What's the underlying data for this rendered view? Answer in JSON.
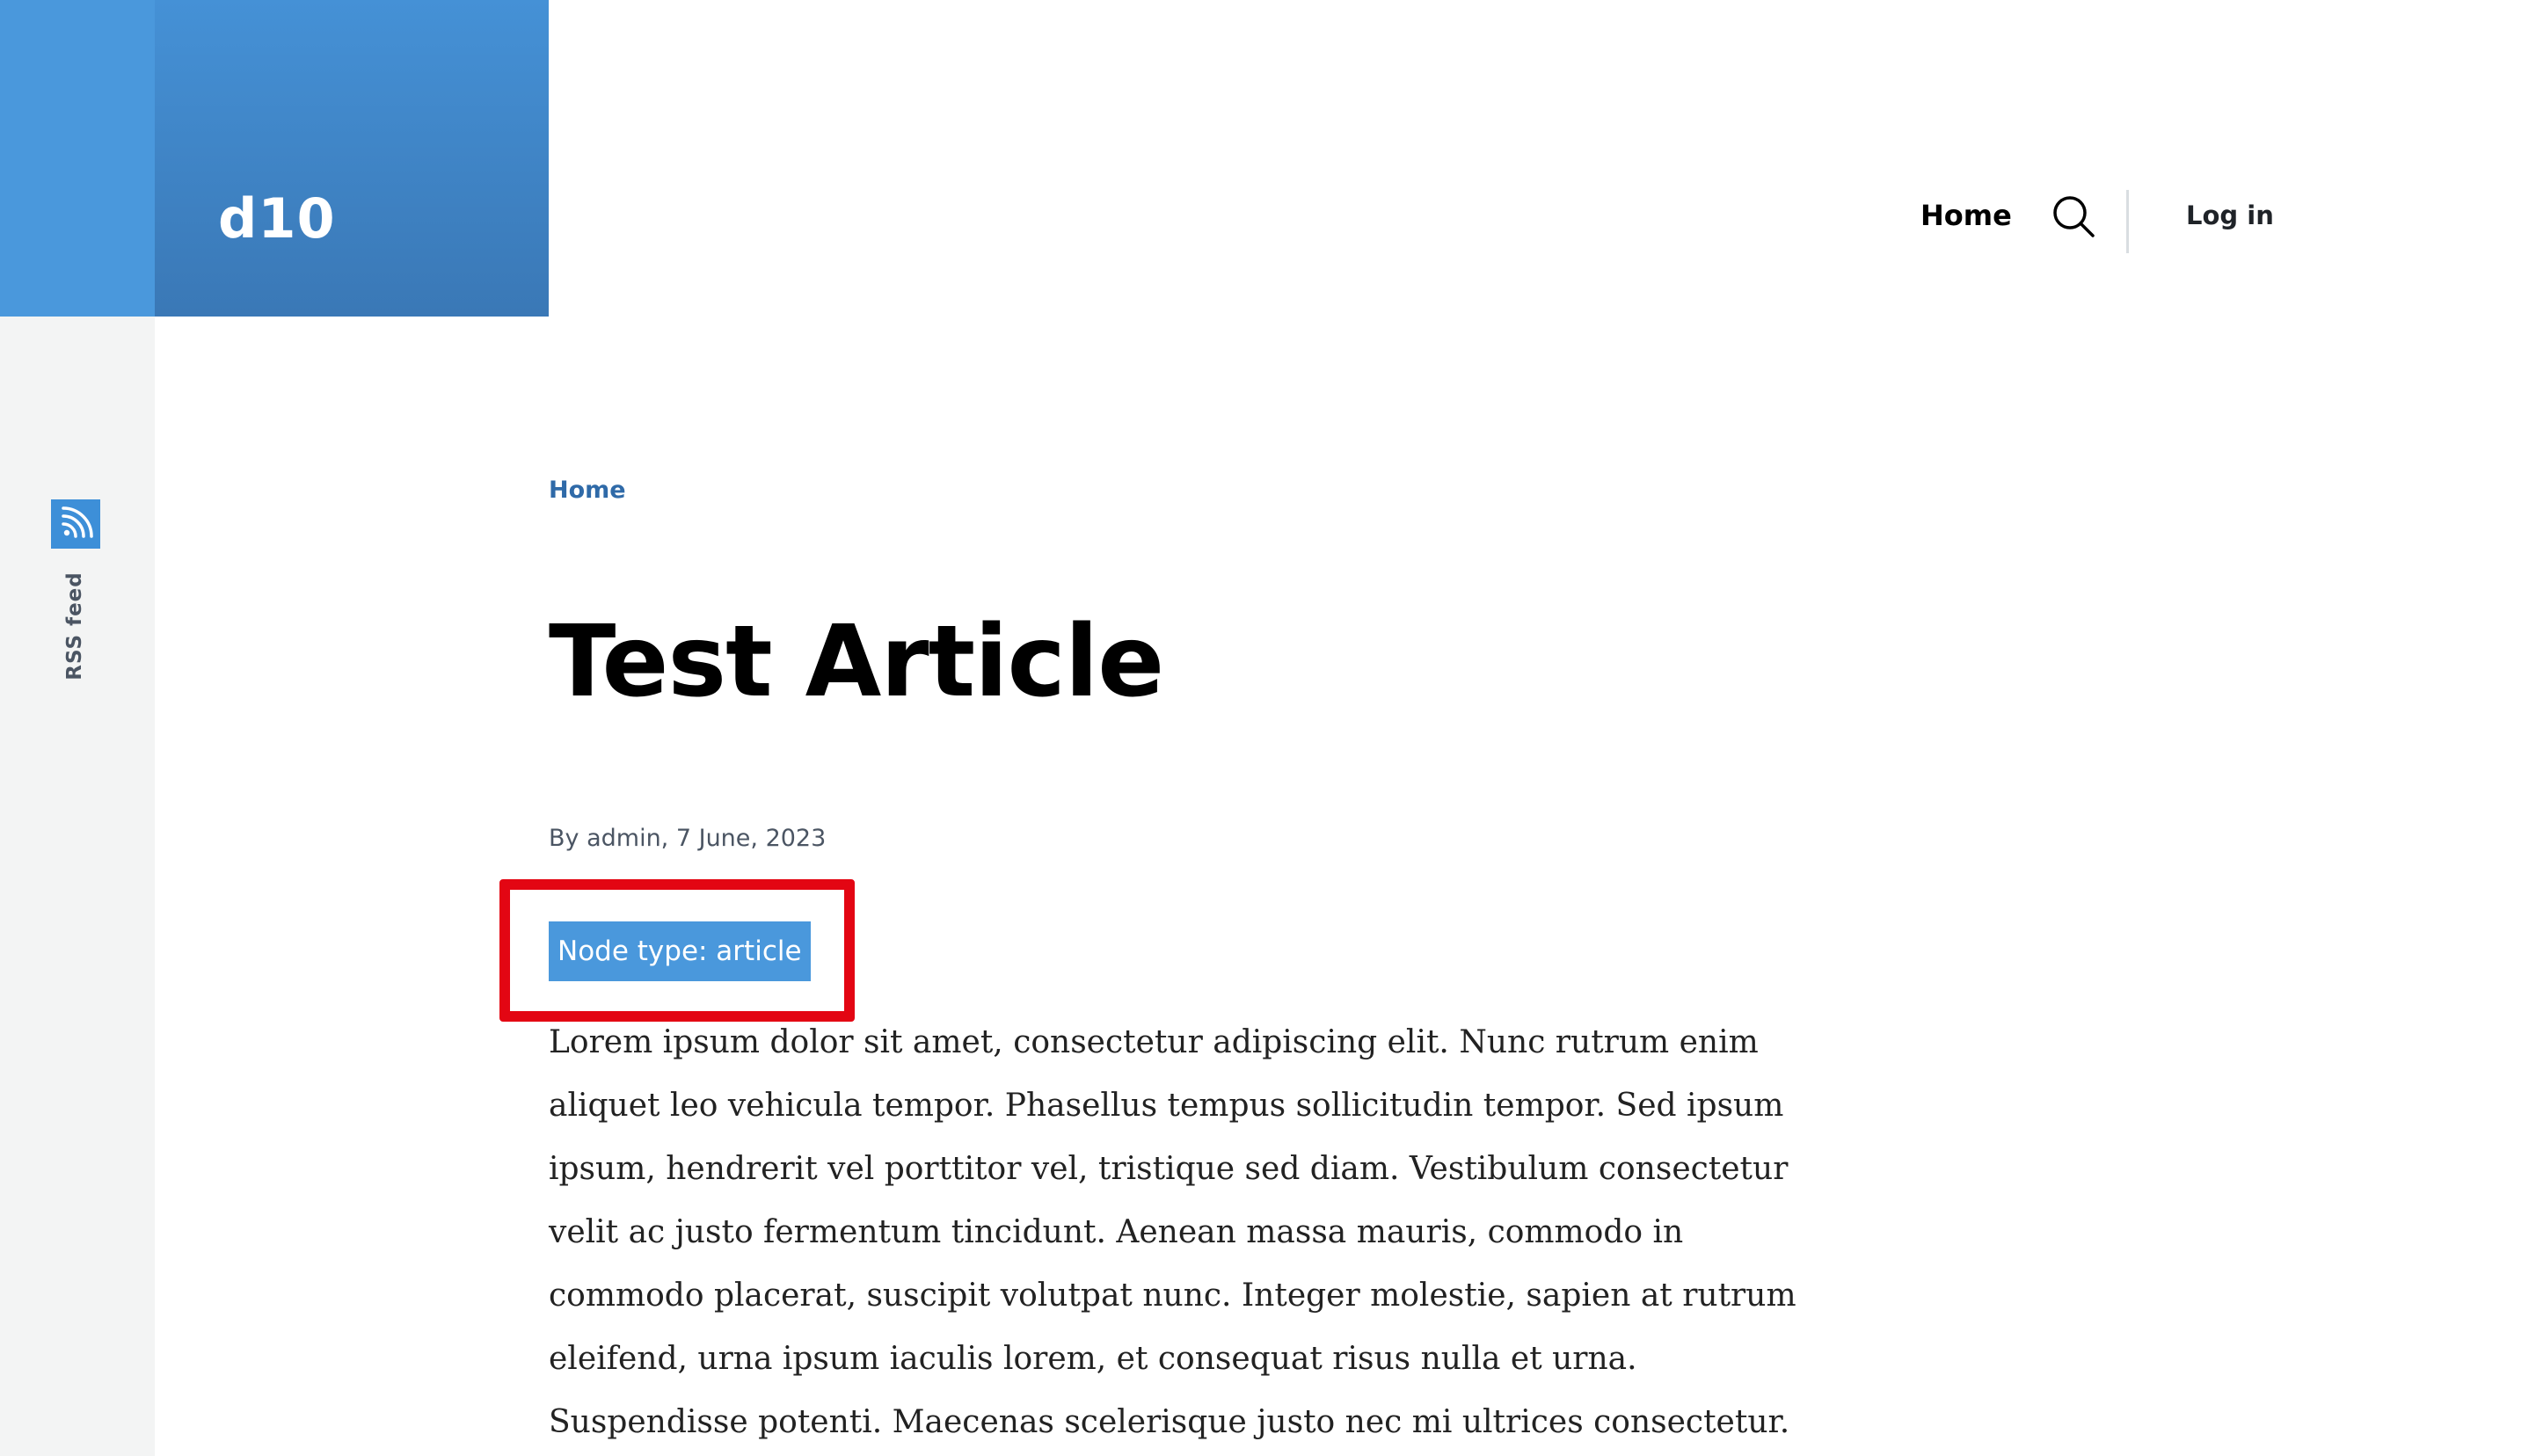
{
  "header": {
    "site_name": "d10",
    "nav": {
      "home_label": "Home",
      "login_label": "Log in"
    }
  },
  "sidebar": {
    "rss_label": "RSS feed"
  },
  "breadcrumb": {
    "home_label": "Home"
  },
  "article": {
    "title": "Test Article",
    "meta": "By admin, 7 June, 2023",
    "node_type": "Node type: article",
    "body": "Lorem ipsum dolor sit amet, consectetur adipiscing elit. Nunc rutrum enim aliquet leo vehicula tempor. Phasellus tempus sollicitudin tempor. Sed ipsum ipsum, hendrerit vel porttitor vel, tristique sed diam. Vestibulum consectetur velit ac justo fermentum tincidunt. Aenean massa mauris, commodo in commodo placerat, suscipit volutpat nunc. Integer molestie, sapien at rutrum eleifend, urna ipsum iaculis lorem, et consequat risus nulla et urna. Suspendisse potenti. Maecenas scelerisque justo nec mi ultrices consectetur. Nullam commodo, nisl nec hendrerit pulvinar, felis urna"
  },
  "colors": {
    "brand_blue": "#4a98dc",
    "brand_blue_dark": "#3a78b6",
    "link_blue": "#2f6aa8",
    "highlight_red": "#e30613",
    "rail_gray": "#f3f4f4"
  },
  "icons": {
    "search": "search-icon",
    "rss": "rss-icon"
  }
}
